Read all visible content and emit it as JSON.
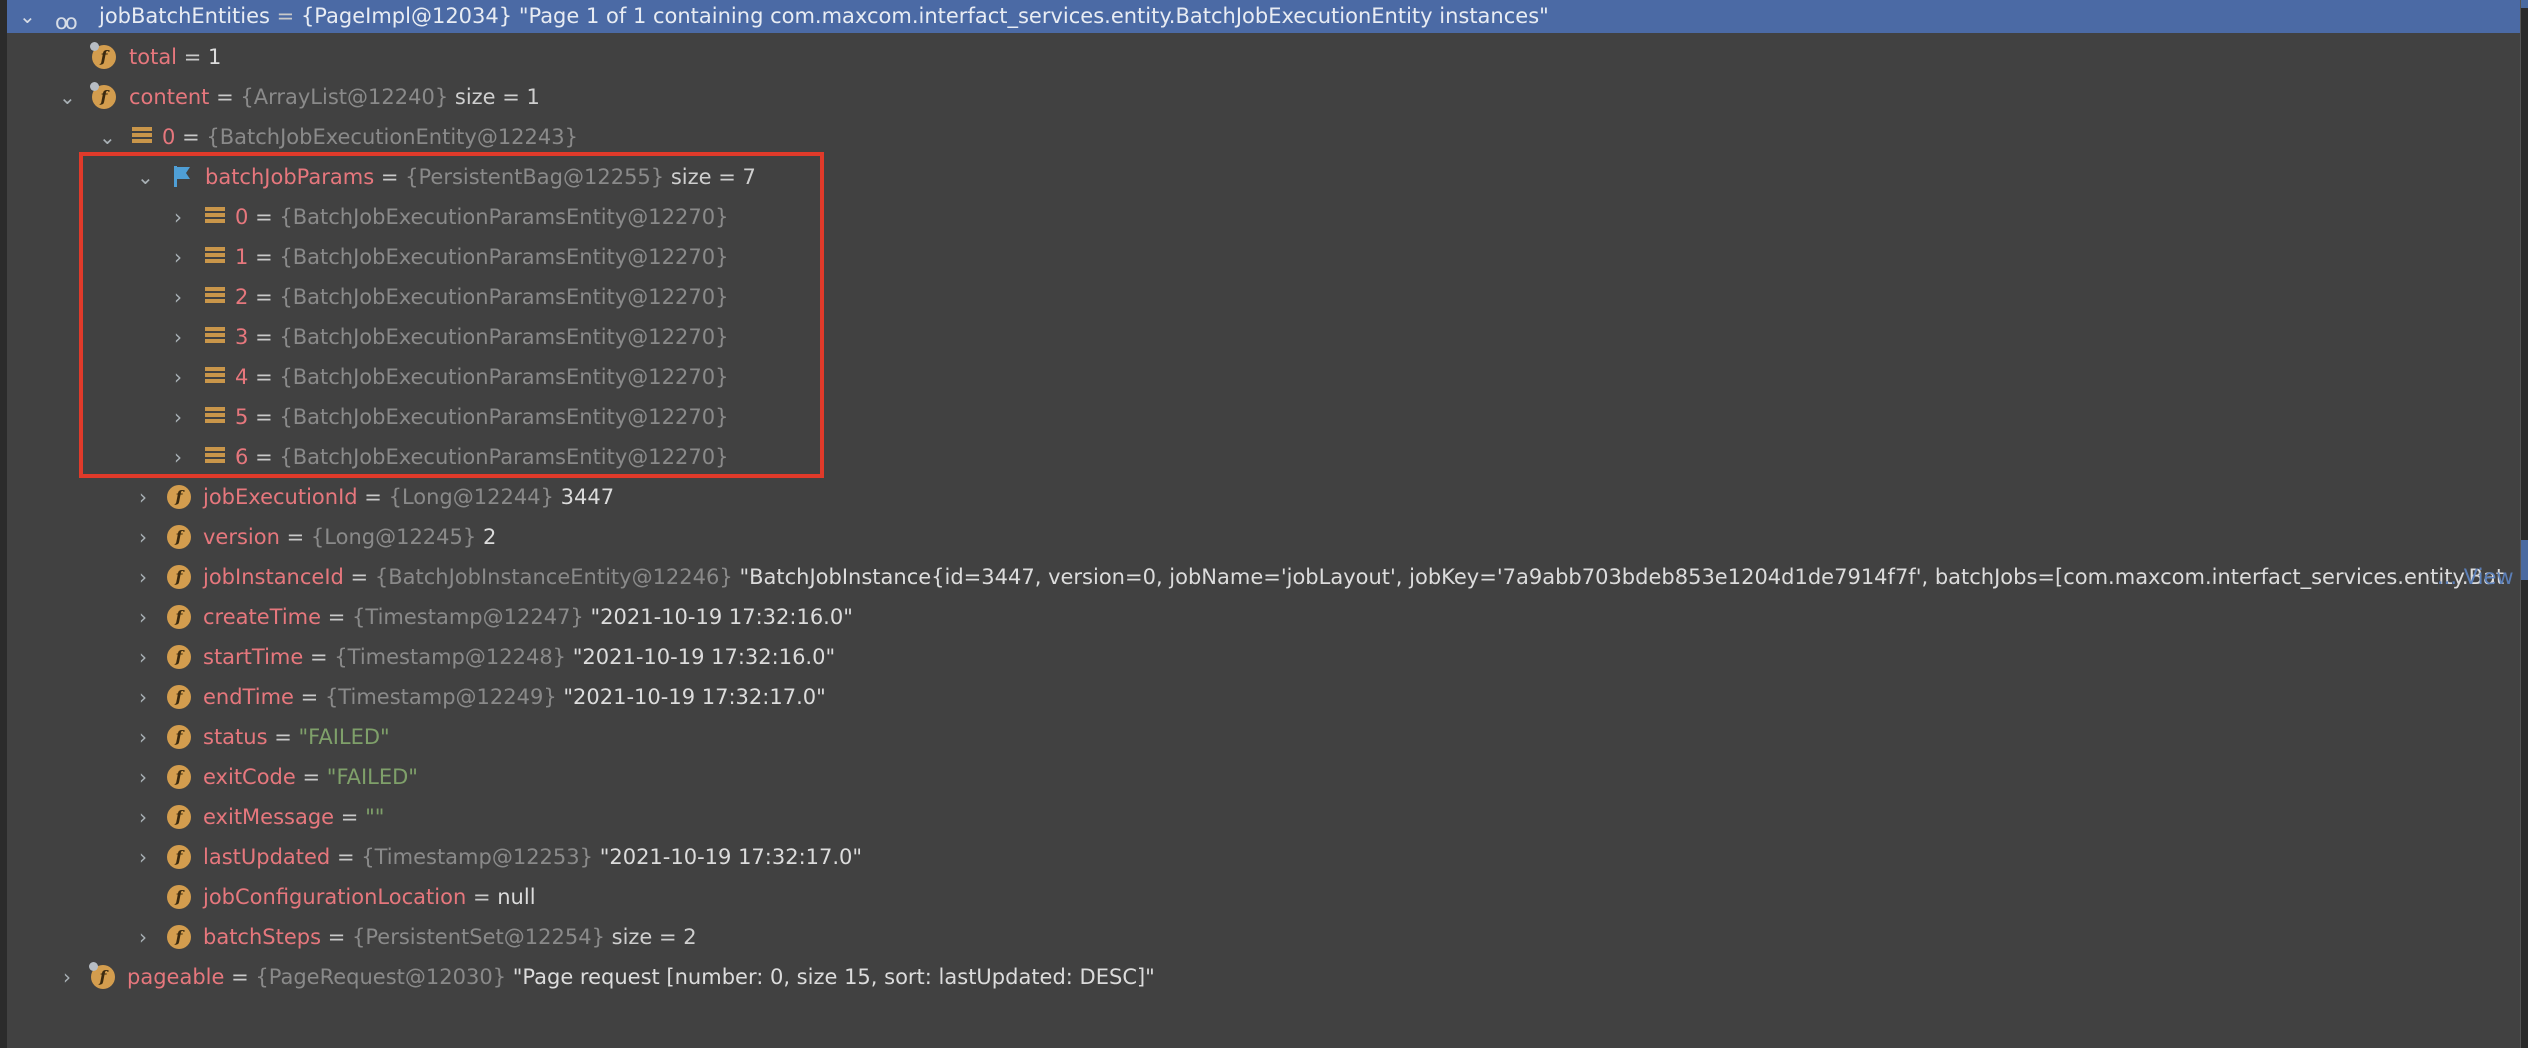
{
  "tree": {
    "root": {
      "name": "jobBatchEntities",
      "type": "{PageImpl@12034}",
      "value": "\"Page 1 of 1 containing com.maxcom.interfact_services.entity.BatchJobExecutionEntity instances\"",
      "icon": "watch-icon",
      "expanded": true
    },
    "total": {
      "name": "total",
      "value": "1"
    },
    "content": {
      "name": "content",
      "type": "{ArrayList@12240}",
      "meta": "size = 1",
      "expanded": true
    },
    "item0": {
      "name": "0",
      "type": "{BatchJobExecutionEntity@12243}",
      "expanded": true
    },
    "batchJobParams": {
      "name": "batchJobParams",
      "type": "{PersistentBag@12255}",
      "meta": "size = 7",
      "expanded": true
    },
    "params": [
      {
        "name": "0",
        "type": "{BatchJobExecutionParamsEntity@12270}"
      },
      {
        "name": "1",
        "type": "{BatchJobExecutionParamsEntity@12270}"
      },
      {
        "name": "2",
        "type": "{BatchJobExecutionParamsEntity@12270}"
      },
      {
        "name": "3",
        "type": "{BatchJobExecutionParamsEntity@12270}"
      },
      {
        "name": "4",
        "type": "{BatchJobExecutionParamsEntity@12270}"
      },
      {
        "name": "5",
        "type": "{BatchJobExecutionParamsEntity@12270}"
      },
      {
        "name": "6",
        "type": "{BatchJobExecutionParamsEntity@12270}"
      }
    ],
    "fields": [
      {
        "name": "jobExecutionId",
        "type": "{Long@12244}",
        "value": "3447",
        "kind": "val"
      },
      {
        "name": "version",
        "type": "{Long@12245}",
        "value": "2",
        "kind": "val"
      },
      {
        "name": "jobInstanceId",
        "type": "{BatchJobInstanceEntity@12246}",
        "value": "\"BatchJobInstance{id=3447, version=0, jobName='jobLayout', jobKey='7a9abb703bdeb853e1204d1de7914f7f', batchJobs=[com.maxcom.interfact_services.entity.Bat",
        "kind": "val",
        "link": "... View"
      },
      {
        "name": "createTime",
        "type": "{Timestamp@12247}",
        "value": "\"2021-10-19 17:32:16.0\"",
        "kind": "val"
      },
      {
        "name": "startTime",
        "type": "{Timestamp@12248}",
        "value": "\"2021-10-19 17:32:16.0\"",
        "kind": "val"
      },
      {
        "name": "endTime",
        "type": "{Timestamp@12249}",
        "value": "\"2021-10-19 17:32:17.0\"",
        "kind": "val"
      },
      {
        "name": "status",
        "type": "",
        "value": "\"FAILED\"",
        "kind": "str"
      },
      {
        "name": "exitCode",
        "type": "",
        "value": "\"FAILED\"",
        "kind": "str"
      },
      {
        "name": "exitMessage",
        "type": "",
        "value": "\"\"",
        "kind": "str"
      },
      {
        "name": "lastUpdated",
        "type": "{Timestamp@12253}",
        "value": "\"2021-10-19 17:32:17.0\"",
        "kind": "val"
      },
      {
        "name": "jobConfigurationLocation",
        "type": "",
        "value": "null",
        "kind": "val",
        "leaf": true
      },
      {
        "name": "batchSteps",
        "type": "{PersistentSet@12254}",
        "value": "size = 2",
        "kind": "meta"
      }
    ],
    "pageable": {
      "name": "pageable",
      "type": "{PageRequest@12030}",
      "value": "\"Page request [number: 0, size 15, sort: lastUpdated: DESC]\""
    },
    "equals_sign": "=",
    "chevron_expanded": "⌄",
    "chevron_collapsed": "›"
  },
  "colors": {
    "selection": "#4b6aa5",
    "highlight_box": "#e03a2a",
    "field_name": "#e6777d",
    "string_value": "#7fa06a",
    "field_icon": "#d39d4e"
  }
}
